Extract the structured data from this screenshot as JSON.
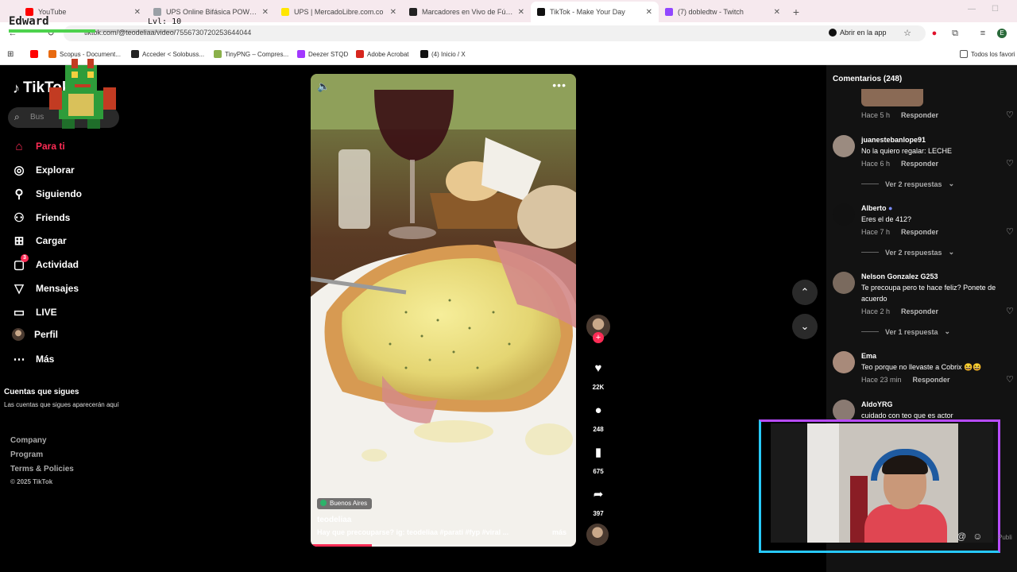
{
  "browser": {
    "tabs": [
      {
        "label": "YouTube",
        "color": "#ff0000"
      },
      {
        "label": "UPS Online Bifásica POWEST 10",
        "color": "#9aa0a6"
      },
      {
        "label": "UPS | MercadoLibre.com.co",
        "color": "#ffe600"
      },
      {
        "label": "Marcadores en Vivo de Fútbol,",
        "color": "#222222"
      },
      {
        "label": "TikTok - Make Your Day",
        "color": "#111111"
      },
      {
        "label": "(7) dobledtw - Twitch",
        "color": "#9146ff"
      }
    ],
    "url": "tiktok.com/@teodeliaa/video/7556730720253644044",
    "open_in_app": "Abrir en la app",
    "bookmarks": [
      {
        "label": "Scopus - Document...",
        "color": "#e86a10"
      },
      {
        "label": "Acceder < Solobuss...",
        "color": "#222222"
      },
      {
        "label": "TinyPNG – Compres...",
        "color": "#8ab04a"
      },
      {
        "label": "Deezer STQD",
        "color": "#a238ff"
      },
      {
        "label": "Adobe Acrobat",
        "color": "#d7261e"
      },
      {
        "label": "(4) Inicio / X",
        "color": "#111111"
      }
    ],
    "all_bookmarks": "Todos los favori"
  },
  "overlay": {
    "name": "Edward",
    "level": "Lvl: 10",
    "xp_fraction": 0.52
  },
  "sidebar": {
    "logo": "TikTok",
    "search_placeholder": "Bus",
    "items": [
      {
        "label": "Para ti",
        "icon": "home-icon",
        "active": true
      },
      {
        "label": "Explorar",
        "icon": "compass-icon"
      },
      {
        "label": "Siguiendo",
        "icon": "following-icon"
      },
      {
        "label": "Friends",
        "icon": "friends-icon"
      },
      {
        "label": "Cargar",
        "icon": "upload-icon"
      },
      {
        "label": "Actividad",
        "icon": "activity-icon",
        "badge": "3"
      },
      {
        "label": "Mensajes",
        "icon": "messages-icon"
      },
      {
        "label": "LIVE",
        "icon": "live-icon"
      },
      {
        "label": "Perfil",
        "icon": "profile-icon"
      },
      {
        "label": "Más",
        "icon": "more-icon"
      }
    ],
    "following_title": "Cuentas que sigues",
    "following_sub": "Las cuentas que sigues aparecerán aquí",
    "footer": [
      "Company",
      "Program",
      "Terms & Policies"
    ],
    "copyright": "© 2025 TikTok"
  },
  "video": {
    "location": "Buenos Aires",
    "author": "teodeliaa",
    "description": "Hay que precouparse? ig: teodeliaa #parati #fyp #viral ...",
    "more_label": "más",
    "progress_fraction": 0.23,
    "likes": "22K",
    "comments": "248",
    "saves": "675",
    "shares": "397"
  },
  "comments": {
    "title": "Comentarios (248)",
    "reply_label": "Responder",
    "items": [
      {
        "user": "",
        "text": "",
        "time": "Hace 5 h"
      },
      {
        "user": "juanestebanlope91",
        "text": "No la quiero regalar: LECHE",
        "time": "Hace 6 h",
        "replies": "Ver 2 respuestas"
      },
      {
        "user": "Alberto",
        "text": "Eres el de 412?",
        "time": "Hace 7 h",
        "replies": "Ver 2 respuestas"
      },
      {
        "user": "Nelson Gonzalez G253",
        "text": "Te precoupa pero te hace feliz? Ponete de acuerdo",
        "time": "Hace 2 h",
        "replies": "Ver 1 respuesta"
      },
      {
        "user": "Ema",
        "text": "Teo porque no llevaste a Cobrix 😆😆",
        "time": "Hace 23 min"
      },
      {
        "user": "AldoYRG",
        "text": "cuidado con teo que es actor",
        "time": ""
      }
    ]
  },
  "cam": {
    "publi": "Publi"
  }
}
